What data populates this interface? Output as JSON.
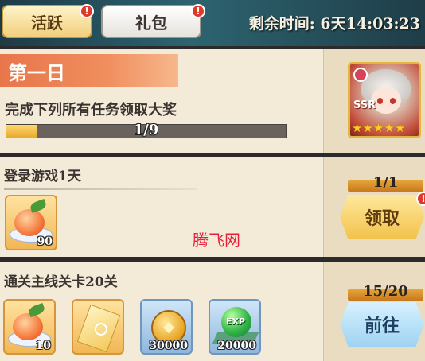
{
  "tabs": {
    "activity": "活跃",
    "gift": "礼包",
    "badge": "!"
  },
  "timer": "剩余时间: 6天14:03:23",
  "day": {
    "title": "第一日",
    "description": "完成下列所有任务领取大奖",
    "progress_text": "1/9",
    "progress_fraction": 0.111
  },
  "reward_card": {
    "rarity": "SSR",
    "stars": 5
  },
  "tasks": [
    {
      "title": "登录游戏1天",
      "counter": "1/1",
      "button": "领取",
      "rewards": [
        {
          "icon": "peach",
          "qty": "90"
        }
      ]
    },
    {
      "title": "通关主线关卡20关",
      "counter": "15/20",
      "button": "前往",
      "rewards": [
        {
          "icon": "peach",
          "qty": "10"
        },
        {
          "icon": "ticket",
          "qty": ""
        },
        {
          "icon": "gold-coin",
          "qty": "30000"
        },
        {
          "icon": "exp-orb",
          "qty": "20000",
          "label": "EXP"
        }
      ]
    }
  ],
  "watermark": "腾飞网",
  "colors": {
    "accent_orange": "#e8764a",
    "progress_fill": "#e9a82a",
    "claim_button": "#f2c24a",
    "go_button": "#9fd3f2",
    "badge_red": "#e0392c"
  }
}
